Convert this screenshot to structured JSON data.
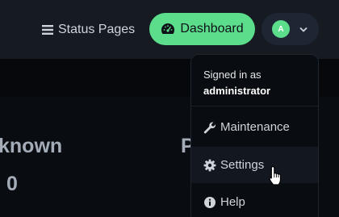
{
  "header": {
    "status_pages_label": "Status Pages",
    "dashboard_label": "Dashboard",
    "avatar_initial": "A"
  },
  "stats": [
    {
      "label": "known",
      "value": "0"
    },
    {
      "label": "P",
      "value": ""
    }
  ],
  "profile_menu": {
    "signed_in_prefix": "Signed in as",
    "username": "administrator",
    "items": [
      {
        "label": "Maintenance",
        "icon": "wrench-icon"
      },
      {
        "label": "Settings",
        "icon": "gear-icon"
      },
      {
        "label": "Help",
        "icon": "info-icon"
      }
    ]
  },
  "colors": {
    "accent": "#5cdd8b",
    "topbar": "#161b22",
    "background": "#090c10"
  }
}
